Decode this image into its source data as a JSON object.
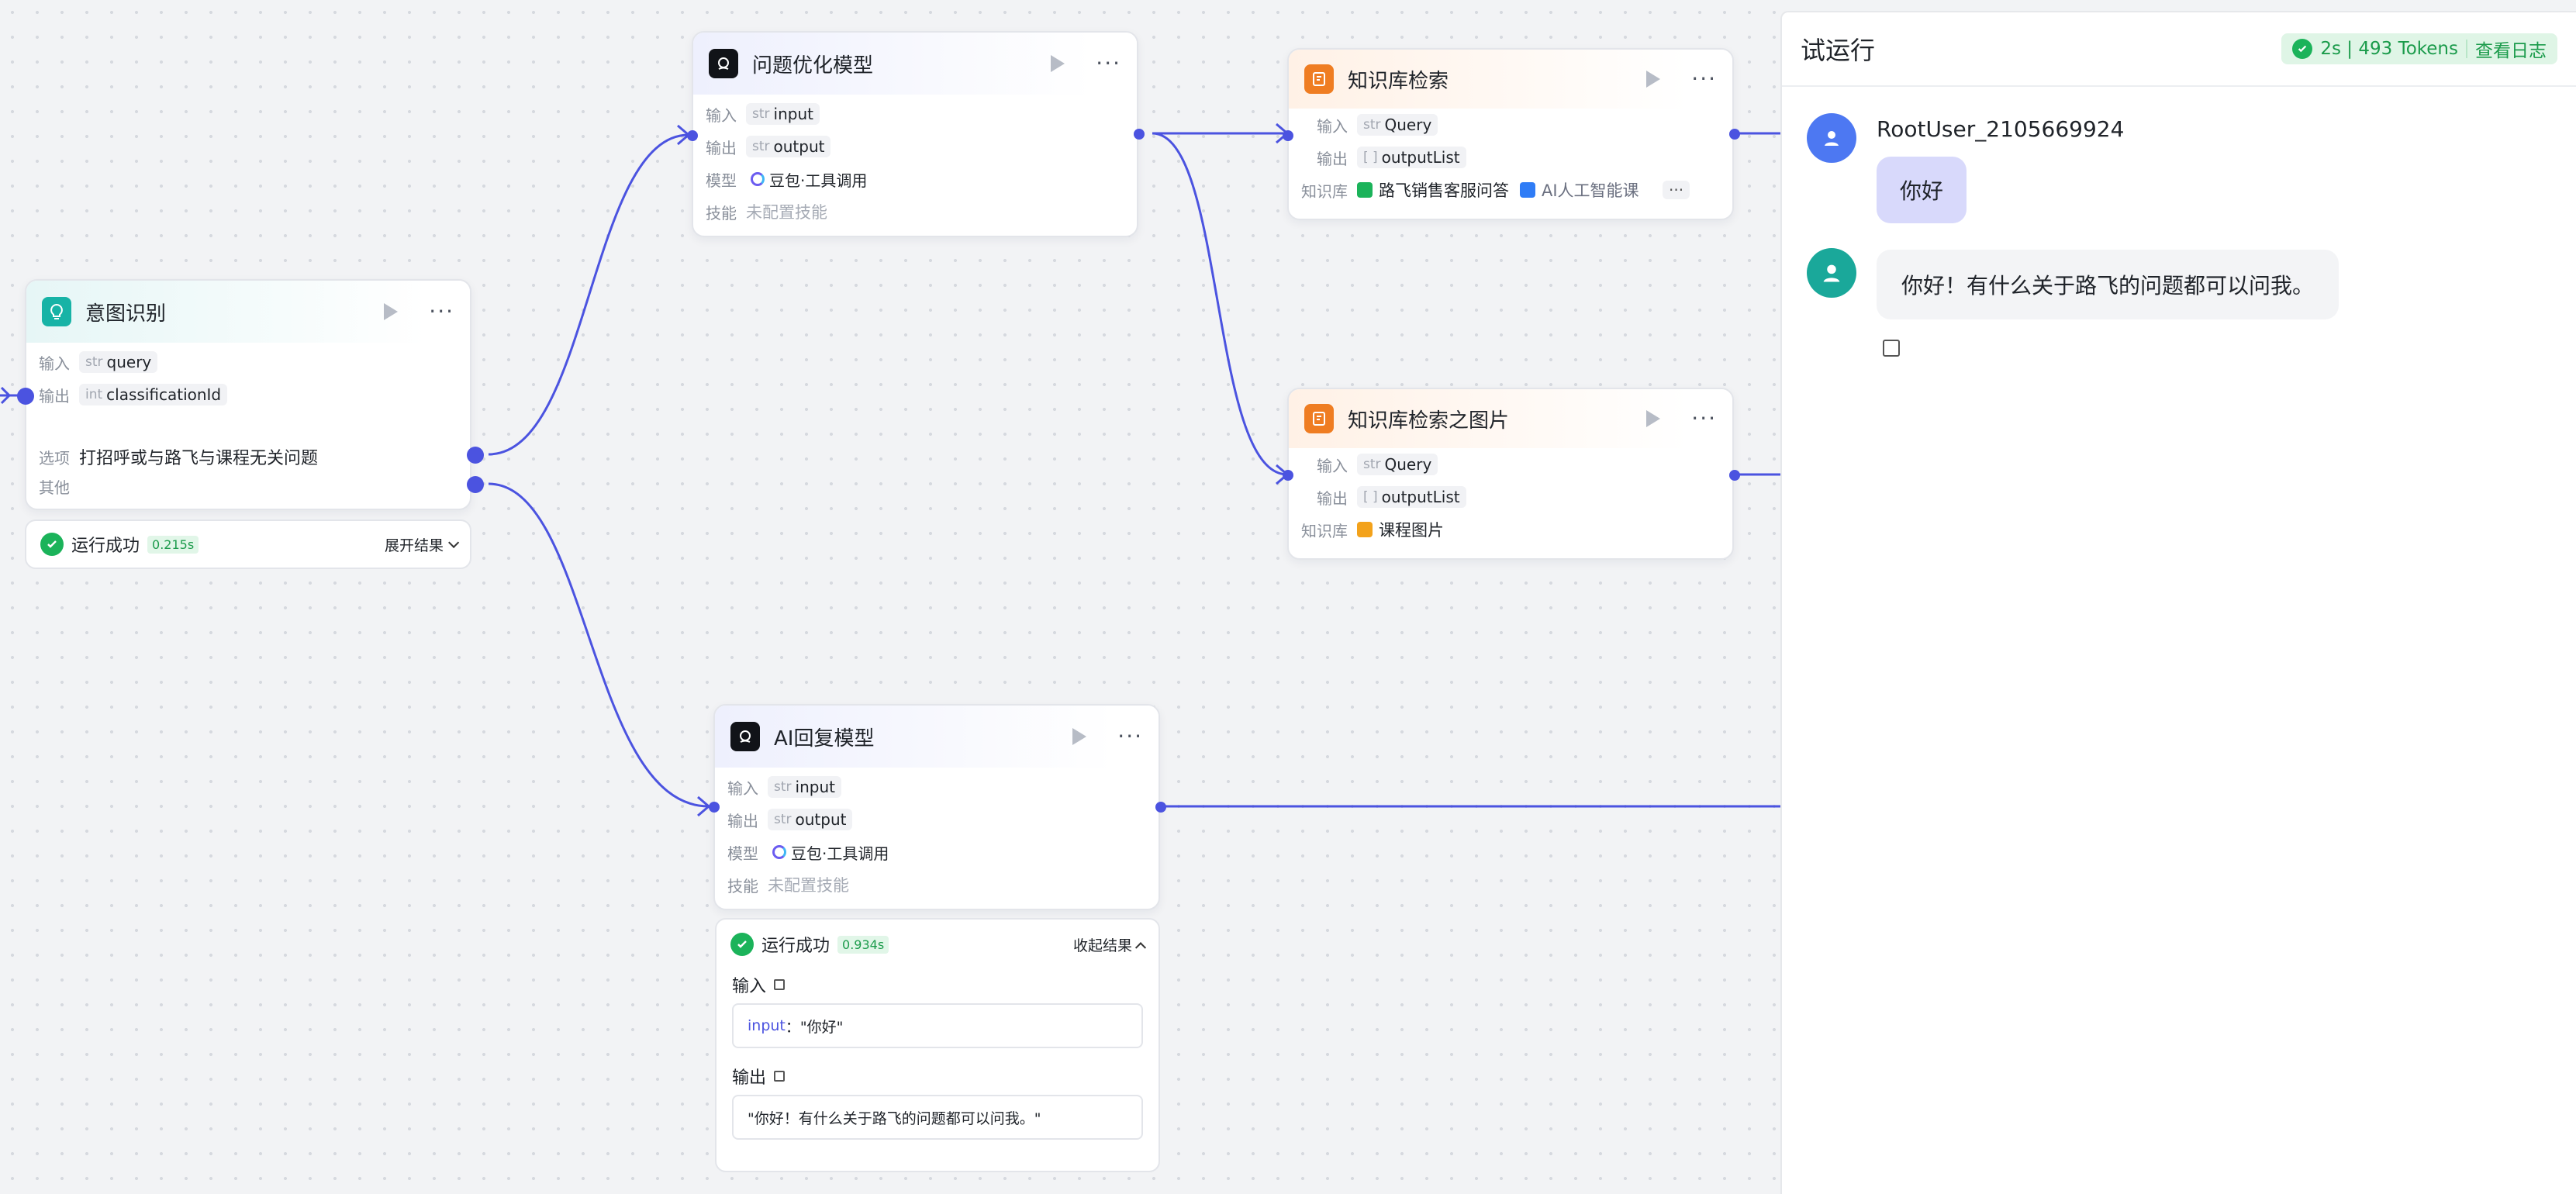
{
  "nodes": {
    "intent": {
      "title": "意图识别",
      "input_label": "输入",
      "input_type": "str",
      "input_name": "query",
      "output_label": "输出",
      "output_type": "int",
      "output_name": "classificationId",
      "option_label": "选项",
      "option_text": "打招呼或与路飞与课程无关问题",
      "other_label": "其他",
      "result": {
        "status": "运行成功",
        "time": "0.215s",
        "toggle": "展开结果"
      }
    },
    "optimize": {
      "title": "问题优化模型",
      "input_label": "输入",
      "input_type": "str",
      "input_name": "input",
      "output_label": "输出",
      "output_type": "str",
      "output_name": "output",
      "model_label": "模型",
      "model_name": "豆包·工具调用",
      "skill_label": "技能",
      "skill_value": "未配置技能"
    },
    "kb_search": {
      "title": "知识库检索",
      "input_label": "输入",
      "input_type": "str",
      "input_name": "Query",
      "output_label": "输出",
      "output_type": "[ ]",
      "output_name": "outputList",
      "kb_label": "知识库",
      "kb_items": [
        "路飞销售客服问答",
        "AI人工智能课"
      ],
      "kb_more": "···"
    },
    "kb_image": {
      "title": "知识库检索之图片",
      "input_label": "输入",
      "input_type": "str",
      "input_name": "Query",
      "output_label": "输出",
      "output_type": "[ ]",
      "output_name": "outputList",
      "kb_label": "知识库",
      "kb_items": [
        "课程图片"
      ]
    },
    "ai_reply": {
      "title": "AI回复模型",
      "input_label": "输入",
      "input_type": "str",
      "input_name": "input",
      "output_label": "输出",
      "output_type": "str",
      "output_name": "output",
      "model_label": "模型",
      "model_name": "豆包·工具调用",
      "skill_label": "技能",
      "skill_value": "未配置技能",
      "result": {
        "status": "运行成功",
        "time": "0.934s",
        "toggle": "收起结果",
        "in_label": "输入",
        "in_key": "input",
        "in_sep": "：",
        "in_value": "\"你好\"",
        "out_label": "输出",
        "out_value": "\"你好！有什么关于路飞的问题都可以问我。\""
      }
    }
  },
  "panel": {
    "title": "试运行",
    "tokens": "2s | 493 Tokens",
    "log_link": "查看日志",
    "messages": [
      {
        "role": "user",
        "name": "RootUser_2105669924",
        "text": "你好"
      },
      {
        "role": "bot",
        "text": "你好！有什么关于路飞的问题都可以问我。"
      }
    ]
  },
  "colors": {
    "accent": "#4b53e0",
    "success": "#1bb35a",
    "kb_orange": "#ef7d22",
    "intent_teal": "#17b3a6"
  }
}
